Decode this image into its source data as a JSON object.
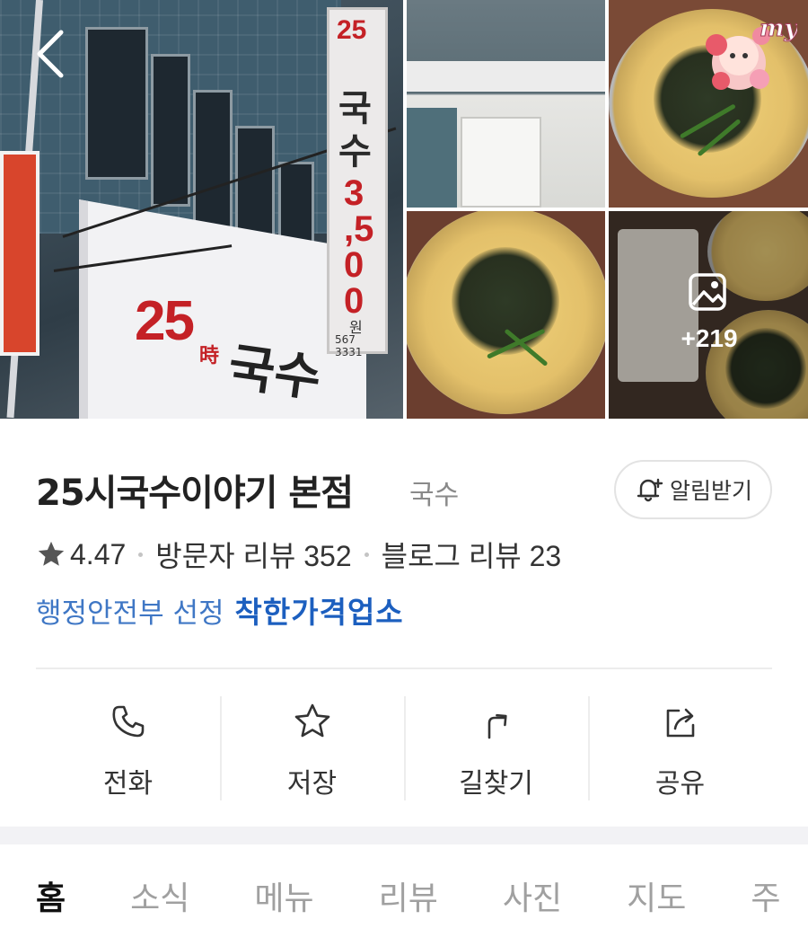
{
  "gallery": {
    "more_count": "+219",
    "sticker_text": "my",
    "storefront_sign": {
      "hours": "25",
      "hours_char": "時",
      "name": "국수",
      "price_digits": [
        "3",
        ",5",
        "0",
        "0"
      ],
      "won": "원",
      "phone": "567 3331"
    }
  },
  "place": {
    "name": "25시국수이야기 본점",
    "category": "국수",
    "alarm_label": "알림받기",
    "rating": "4.47",
    "visitor_reviews": "방문자 리뷰 352",
    "blog_reviews": "블로그 리뷰 23",
    "certification_org": "행정안전부 선정",
    "certification_mark": "착한가격업소"
  },
  "actions": [
    {
      "label": "전화",
      "icon": "phone-icon"
    },
    {
      "label": "저장",
      "icon": "star-icon"
    },
    {
      "label": "길찾기",
      "icon": "directions-icon"
    },
    {
      "label": "공유",
      "icon": "share-icon"
    }
  ],
  "tabs": [
    "홈",
    "소식",
    "메뉴",
    "리뷰",
    "사진",
    "지도",
    "주"
  ],
  "colors": {
    "accent_blue": "#1c5fbf",
    "org_blue": "#3f77c5",
    "sign_red": "#c42126"
  }
}
